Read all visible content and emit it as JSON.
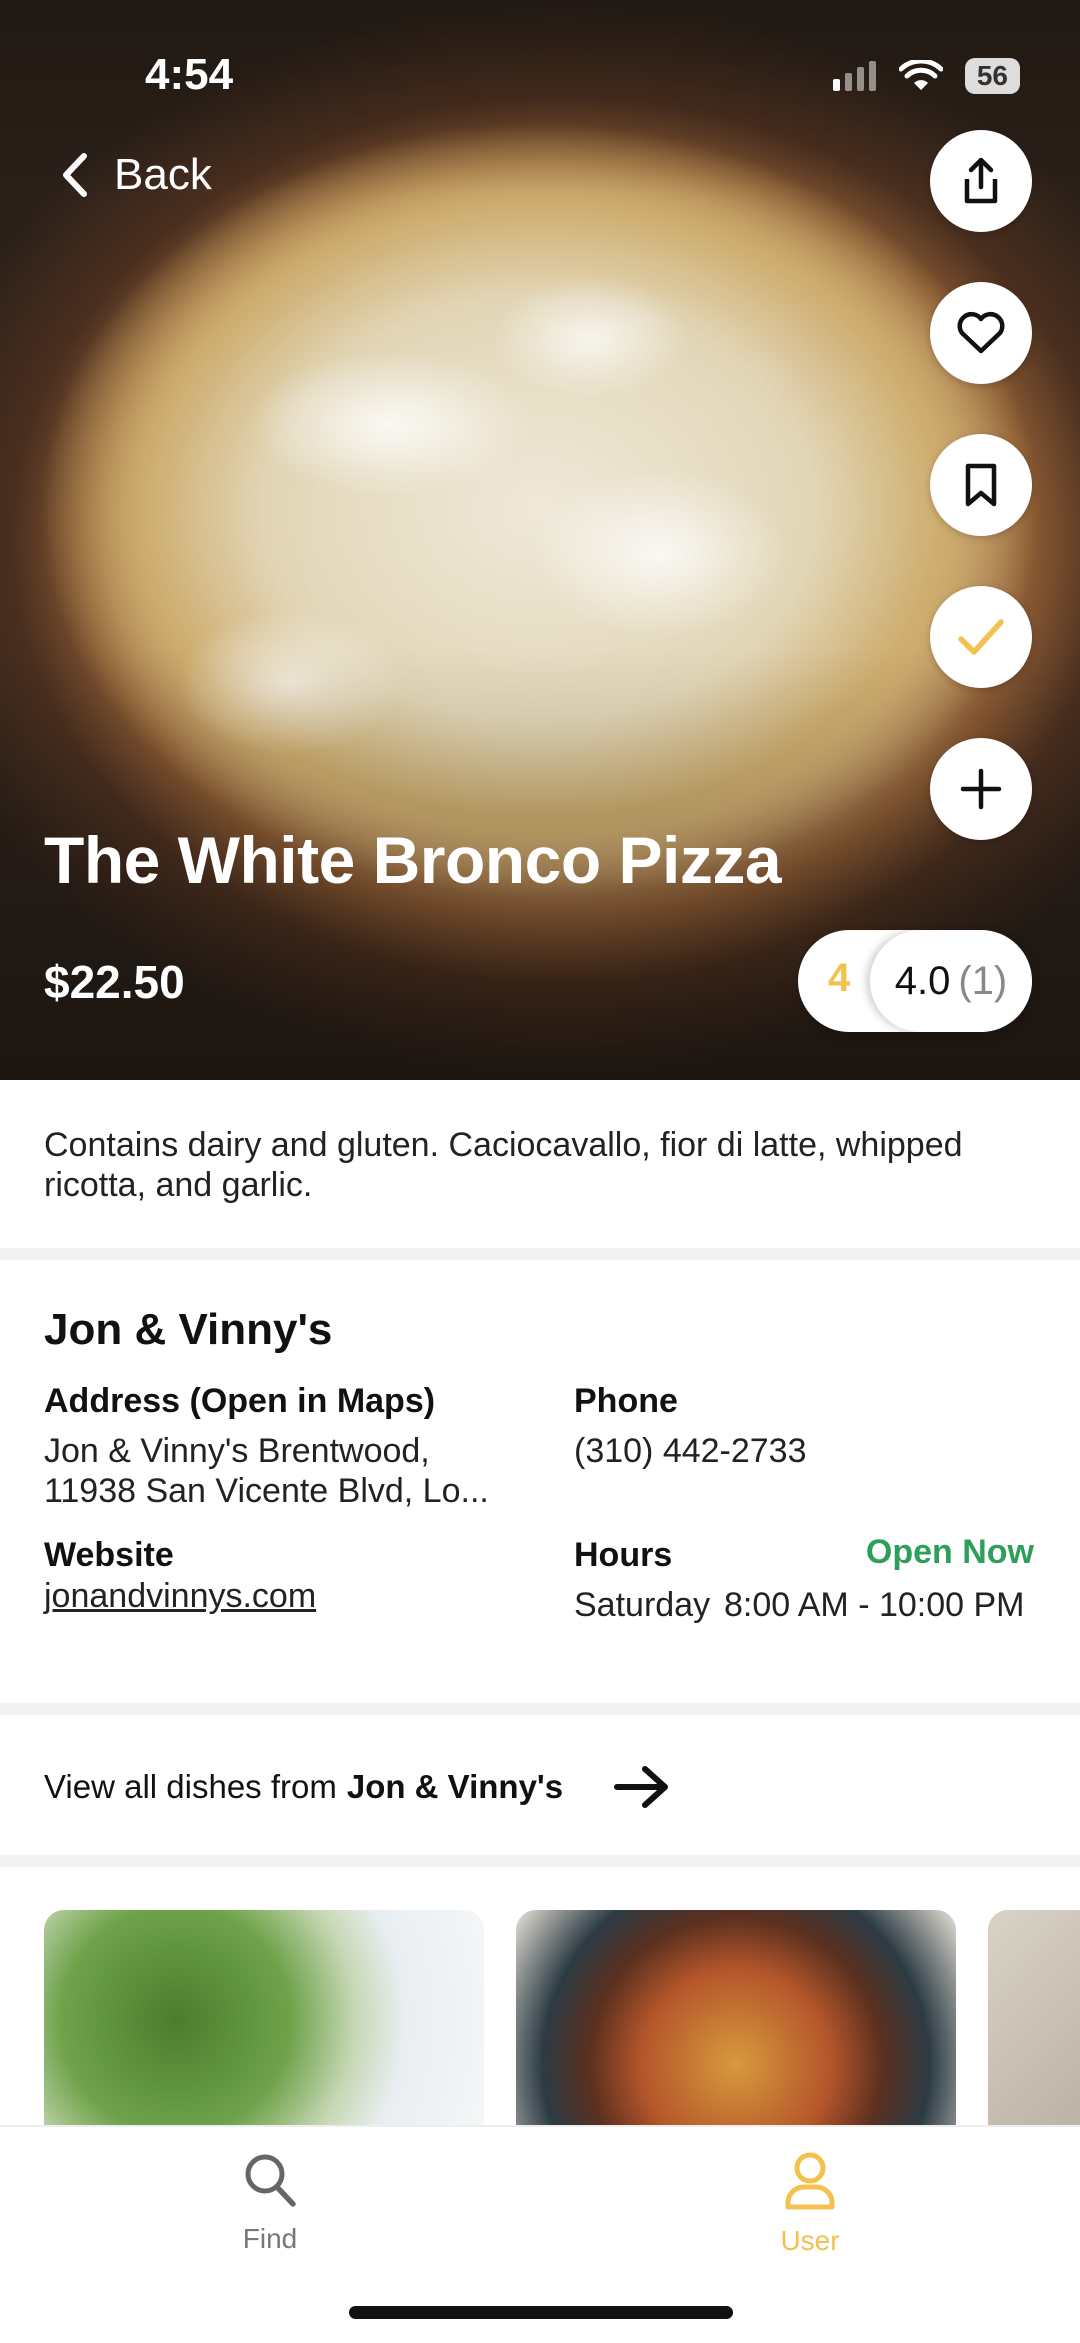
{
  "status": {
    "time": "4:54",
    "battery": "56"
  },
  "nav": {
    "back_label": "Back"
  },
  "dish": {
    "title": "The White Bronco Pizza",
    "price": "$22.50",
    "rating_small": "4",
    "rating_value": "4.0",
    "rating_count": "(1)",
    "description": "Contains dairy and gluten. Caciocavallo, fior di latte, whipped ricotta, and garlic."
  },
  "restaurant": {
    "name": "Jon & Vinny's",
    "address_label": "Address (Open in Maps)",
    "address_line1": "Jon & Vinny's Brentwood,",
    "address_line2": "11938 San Vicente Blvd, Lo...",
    "phone_label": "Phone",
    "phone": "(310) 442-2733",
    "website_label": "Website",
    "website": "jonandvinnys.com",
    "hours_label": "Hours",
    "open_status": "Open Now",
    "hours_day": "Saturday",
    "hours_time": "8:00 AM - 10:00 PM"
  },
  "view_all": {
    "prefix": "View all dishes from",
    "restaurant": "Jon & Vinny's"
  },
  "tabs": [
    {
      "label": "Find",
      "icon": "search-icon"
    },
    {
      "label": "User",
      "icon": "user-icon"
    }
  ],
  "colors": {
    "accent": "#f2c14e",
    "open": "#2e9e5b"
  }
}
